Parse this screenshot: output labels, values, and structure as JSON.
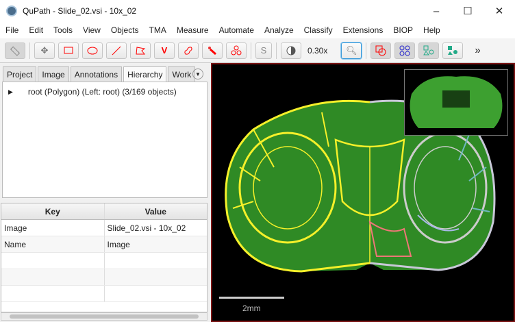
{
  "window": {
    "title": "QuPath - Slide_02.vsi - 10x_02",
    "controls": [
      "–",
      "☐",
      "✕"
    ]
  },
  "menu": [
    "File",
    "Edit",
    "Tools",
    "View",
    "Objects",
    "TMA",
    "Measure",
    "Automate",
    "Analyze",
    "Classify",
    "Extensions",
    "BIOP",
    "Help"
  ],
  "toolbar": {
    "tools": [
      "ruler-icon",
      "move-icon",
      "rectangle-icon",
      "ellipse-icon",
      "line-icon",
      "polygon-icon",
      "polyline-icon",
      "brush-icon",
      "wand-icon",
      "points-icon"
    ],
    "selection_mode": "S",
    "zoom": "0.30x",
    "more": "»"
  },
  "tabs": [
    "Project",
    "Image",
    "Annotations",
    "Hierarchy",
    "Work"
  ],
  "hierarchy": {
    "root": "root (Polygon) (Left: root) (3/169 objects)"
  },
  "table": {
    "headers": [
      "Key",
      "Value"
    ],
    "rows": [
      [
        "Image",
        "Slide_02.vsi - 10x_02"
      ],
      [
        "Name",
        "Image"
      ]
    ]
  },
  "viewer": {
    "scale_label": "2mm"
  },
  "colors": {
    "annotation_left": "#f5f02a",
    "annotation_right": "#c8c8d8",
    "tissue": "#3a9a2a"
  }
}
